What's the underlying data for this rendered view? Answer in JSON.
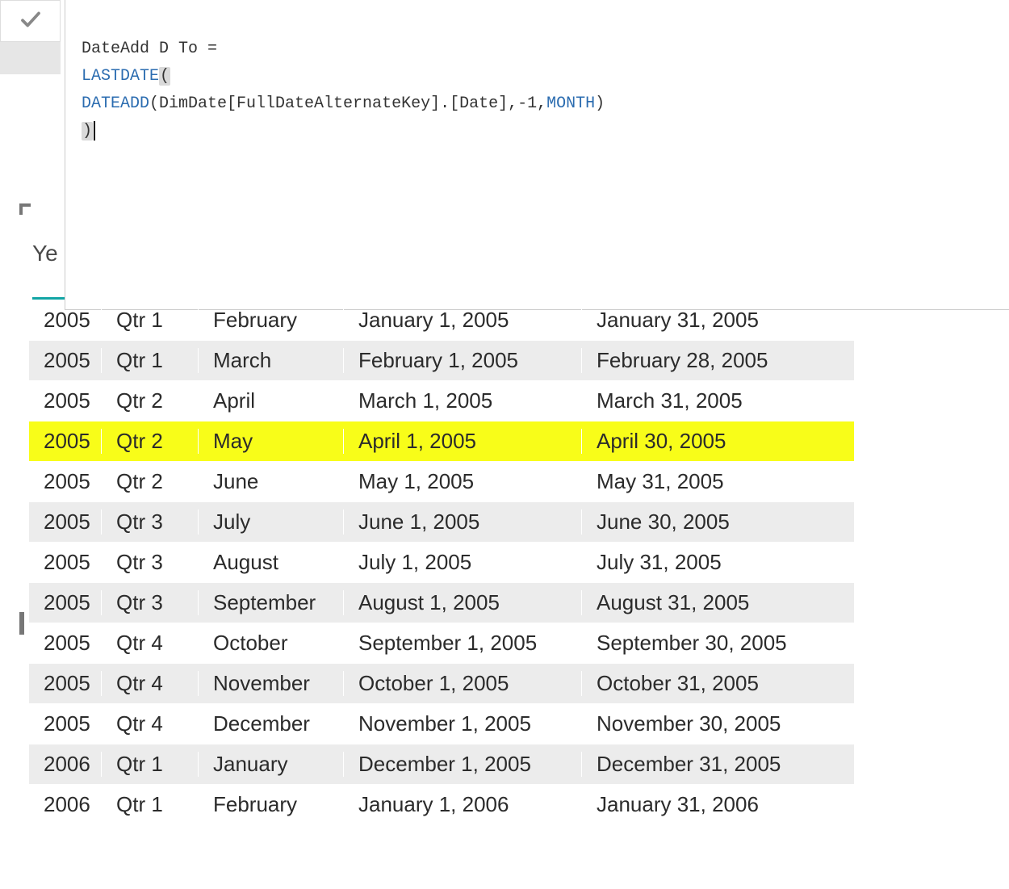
{
  "formula": {
    "line1_prefix": "DateAdd D To =",
    "line2_fn": "LASTDATE",
    "line2_paren": "(",
    "line3_fn": "DATEADD",
    "line3_args": "(DimDate[FullDateAlternateKey].[Date],-1,",
    "line3_fn2": "MONTH",
    "line3_close": ")",
    "line4_paren": ")"
  },
  "header": {
    "visible_text": "Ye"
  },
  "table": {
    "rows": [
      {
        "year": "2005",
        "qtr": "Qtr 1",
        "month": "February",
        "from": "January 1, 2005",
        "to": "January 31, 2005",
        "striped": false,
        "highlight": false
      },
      {
        "year": "2005",
        "qtr": "Qtr 1",
        "month": "March",
        "from": "February 1, 2005",
        "to": "February 28, 2005",
        "striped": true,
        "highlight": false
      },
      {
        "year": "2005",
        "qtr": "Qtr 2",
        "month": "April",
        "from": "March 1, 2005",
        "to": "March 31, 2005",
        "striped": false,
        "highlight": false
      },
      {
        "year": "2005",
        "qtr": "Qtr 2",
        "month": "May",
        "from": "April 1, 2005",
        "to": "April 30, 2005",
        "striped": true,
        "highlight": true
      },
      {
        "year": "2005",
        "qtr": "Qtr 2",
        "month": "June",
        "from": "May 1, 2005",
        "to": "May 31, 2005",
        "striped": false,
        "highlight": false
      },
      {
        "year": "2005",
        "qtr": "Qtr 3",
        "month": "July",
        "from": "June 1, 2005",
        "to": "June 30, 2005",
        "striped": true,
        "highlight": false
      },
      {
        "year": "2005",
        "qtr": "Qtr 3",
        "month": "August",
        "from": "July 1, 2005",
        "to": "July 31, 2005",
        "striped": false,
        "highlight": false
      },
      {
        "year": "2005",
        "qtr": "Qtr 3",
        "month": "September",
        "from": "August 1, 2005",
        "to": "August 31, 2005",
        "striped": true,
        "highlight": false
      },
      {
        "year": "2005",
        "qtr": "Qtr 4",
        "month": "October",
        "from": "September 1, 2005",
        "to": "September 30, 2005",
        "striped": false,
        "highlight": false
      },
      {
        "year": "2005",
        "qtr": "Qtr 4",
        "month": "November",
        "from": "October 1, 2005",
        "to": "October 31, 2005",
        "striped": true,
        "highlight": false
      },
      {
        "year": "2005",
        "qtr": "Qtr 4",
        "month": "December",
        "from": "November 1, 2005",
        "to": "November 30, 2005",
        "striped": false,
        "highlight": false
      },
      {
        "year": "2006",
        "qtr": "Qtr 1",
        "month": "January",
        "from": "December 1, 2005",
        "to": "December 31, 2005",
        "striped": true,
        "highlight": false
      },
      {
        "year": "2006",
        "qtr": "Qtr 1",
        "month": "February",
        "from": "January 1, 2006",
        "to": "January 31, 2006",
        "striped": false,
        "highlight": false
      }
    ]
  }
}
